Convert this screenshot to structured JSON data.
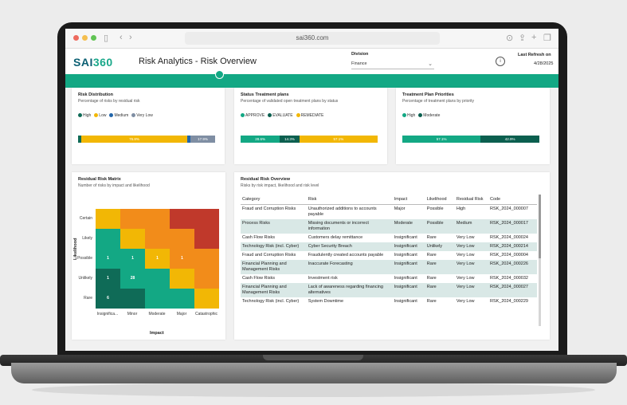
{
  "browser": {
    "url": "sai360.com"
  },
  "header": {
    "logo_main": "SAI",
    "logo_accent": "360",
    "title": "Risk Analytics - Risk Overview",
    "division_label": "Division",
    "division_value": "Finance",
    "refresh_label": "Last Refresh on",
    "refresh_date": "4/28/2025"
  },
  "risk_distribution": {
    "title": "Risk Distribution",
    "subtitle": "Percentage of risks by residual risk",
    "legend": [
      {
        "label": "High",
        "color": "#0f6b57"
      },
      {
        "label": "Low",
        "color": "#f2b705"
      },
      {
        "label": "Medium",
        "color": "#2266aa"
      },
      {
        "label": "Very Low",
        "color": "#7f8ea3"
      }
    ],
    "segments": [
      {
        "label": "",
        "value": 2.5,
        "color": "#0f6b57"
      },
      {
        "label": "76.8%",
        "value": 76.8,
        "color": "#f2b705"
      },
      {
        "label": "",
        "value": 2.5,
        "color": "#2266aa"
      },
      {
        "label": "17.9%",
        "value": 17.9,
        "color": "#7f8ea3"
      }
    ]
  },
  "status_treatment": {
    "title": "Status Treatment plans",
    "subtitle": "Percentage of validated open treatment plans by status",
    "legend": [
      {
        "label": "APPROVE",
        "color": "#13a884"
      },
      {
        "label": "EVALUATE",
        "color": "#0b5f4f"
      },
      {
        "label": "REMEDIATE",
        "color": "#f2b705"
      }
    ],
    "segments": [
      {
        "label": "28.6%",
        "value": 28.6,
        "color": "#13a884"
      },
      {
        "label": "14.3%",
        "value": 14.3,
        "color": "#0b5f4f"
      },
      {
        "label": "57.1%",
        "value": 57.1,
        "color": "#f2b705"
      }
    ]
  },
  "treatment_priorities": {
    "title": "Treatment Plan Priorities",
    "subtitle": "Percentage of treatment plans by priority",
    "legend": [
      {
        "label": "High",
        "color": "#13a884"
      },
      {
        "label": "Moderate",
        "color": "#0b5f4f"
      }
    ],
    "segments": [
      {
        "label": "57.1%",
        "value": 57.1,
        "color": "#13a884"
      },
      {
        "label": "42.9%",
        "value": 42.9,
        "color": "#0b5f4f"
      }
    ]
  },
  "matrix": {
    "title": "Residual Risk Matrix",
    "subtitle": "Number of risks by impact and likelihood",
    "y_axis": "Likelihood",
    "x_axis": "Impact",
    "rows": [
      "Certain",
      "Likely",
      "Possible",
      "Unlikely",
      "Rare"
    ],
    "cols": [
      "Insignifica...",
      "Minor",
      "Moderate",
      "Major",
      "Catastrophic"
    ],
    "colors": [
      [
        "#f2b705",
        "#f28c1a",
        "#f28c1a",
        "#c0392b",
        "#c0392b"
      ],
      [
        "#13a884",
        "#f2b705",
        "#f28c1a",
        "#f28c1a",
        "#c0392b"
      ],
      [
        "#13a884",
        "#13a884",
        "#f2b705",
        "#f28c1a",
        "#f28c1a"
      ],
      [
        "#0f6b57",
        "#13a884",
        "#13a884",
        "#f2b705",
        "#f28c1a"
      ],
      [
        "#0f6b57",
        "#0f6b57",
        "#13a884",
        "#13a884",
        "#f2b705"
      ]
    ],
    "values": [
      [
        "",
        "",
        "",
        "",
        ""
      ],
      [
        "",
        "",
        "",
        "",
        ""
      ],
      [
        "1",
        "1",
        "1",
        "1",
        ""
      ],
      [
        "1",
        "28",
        "",
        "",
        ""
      ],
      [
        "6",
        "",
        "",
        "",
        ""
      ]
    ]
  },
  "overview": {
    "title": "Residual Risk Overview",
    "subtitle": "Risks by risk impact, likelihood and risk level",
    "columns": [
      "Category",
      "Risk",
      "Impact",
      "Likelihood",
      "Residual Risk",
      "Code"
    ],
    "rows": [
      [
        "Fraud and Corruption Risks",
        "Unauthorized additions to accounts payable",
        "Major",
        "Possible",
        "High",
        "RSK_2024_000007"
      ],
      [
        "Process Risks",
        "Missing documents or incorrect information",
        "Moderate",
        "Possible",
        "Medium",
        "RSK_2024_000017"
      ],
      [
        "Cash Flow Risks",
        "Customers delay remittance",
        "Insignificant",
        "Rare",
        "Very Low",
        "RSK_2024_000024"
      ],
      [
        "Technology Risk (incl. Cyber)",
        "Cyber Security Breach",
        "Insignificant",
        "Unlikely",
        "Very Low",
        "RSK_2024_000214"
      ],
      [
        "Fraud and Corruption Risks",
        "Fraudulently created accounts payable",
        "Insignificant",
        "Rare",
        "Very Low",
        "RSK_2024_000004"
      ],
      [
        "Financial Planning and Management Risks",
        "Inaccurate Forecasting",
        "Insignificant",
        "Rare",
        "Very Low",
        "RSK_2024_000226"
      ],
      [
        "Cash Flow Risks",
        "Investment risk",
        "Insignificant",
        "Rare",
        "Very Low",
        "RSK_2024_000032"
      ],
      [
        "Financial Planning and Management Risks",
        "Lack of awareness regarding financing alternatives",
        "Insignificant",
        "Rare",
        "Very Low",
        "RSK_2024_000027"
      ],
      [
        "Technology Risk (incl. Cyber)",
        "System Downtime",
        "Insignificant",
        "Rare",
        "Very Low",
        "RSK_2024_000229"
      ]
    ]
  }
}
